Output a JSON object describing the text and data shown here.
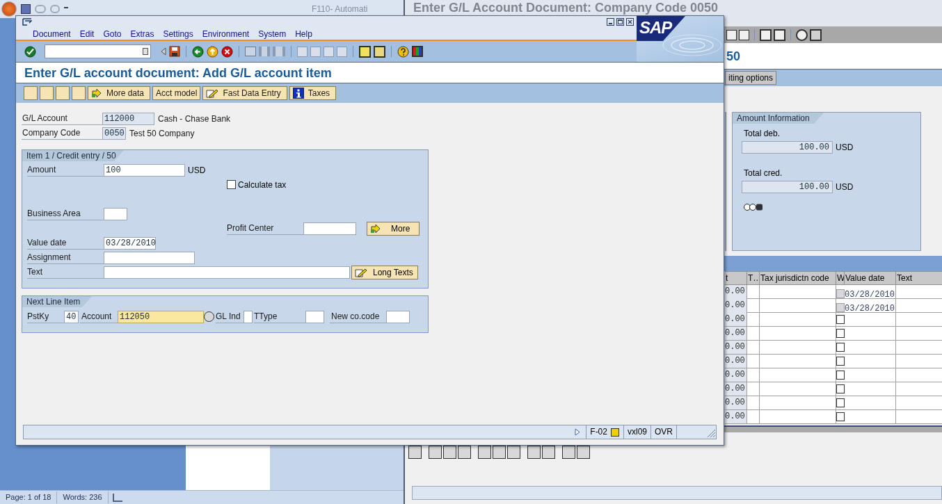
{
  "word": {
    "title": "F110- Automati",
    "status": [
      "Page: 1 of 18",
      "Words: 236"
    ]
  },
  "main_window": {
    "title": "Enter G/L Account Document: Company Code 0050",
    "heading": "50",
    "button": "iting options",
    "amount_panel": {
      "title": "Amount Information",
      "totals": [
        {
          "label": "Total deb.",
          "value": "100.00",
          "currency": "USD"
        },
        {
          "label": "Total cred.",
          "value": "100.00",
          "currency": "USD"
        }
      ]
    },
    "table": {
      "columns": [
        "t",
        "T…",
        "Tax jurisdictn code",
        "W",
        "Value date",
        "Text"
      ],
      "rows": [
        {
          "amount": "0.00",
          "value_date": "03/28/2010",
          "marked": true
        },
        {
          "amount": "0.00",
          "value_date": "03/28/2010",
          "marked": true
        },
        {
          "amount": "0.00",
          "marked": false
        },
        {
          "amount": "0.00",
          "marked": false
        },
        {
          "amount": "0.00",
          "marked": false
        },
        {
          "amount": "0.00",
          "marked": false
        },
        {
          "amount": "0.00",
          "marked": false
        },
        {
          "amount": "0.00",
          "marked": false
        },
        {
          "amount": "0.00",
          "marked": false
        },
        {
          "amount": "0.00",
          "marked": false
        }
      ]
    }
  },
  "dialog": {
    "logo_text": "SAP",
    "menu": [
      "Document",
      "Edit",
      "Goto",
      "Extras",
      "Settings",
      "Environment",
      "System",
      "Help"
    ],
    "title": "Enter G/L account document: Add G/L account item",
    "buttons": [
      {
        "label": "More data",
        "kind": "arrow"
      },
      {
        "label": "Acct model",
        "kind": "plain"
      },
      {
        "label": "Fast Data Entry",
        "kind": "pen"
      },
      {
        "label": "Taxes",
        "kind": "info"
      }
    ],
    "header": [
      {
        "label": "G/L Account",
        "value": "112000",
        "text": "Cash - Chase Bank"
      },
      {
        "label": "Company Code",
        "value": "0050",
        "text": "Test 50 Company"
      }
    ],
    "item": {
      "title": "Item 1 / Credit entry / 50",
      "amount": {
        "label": "Amount",
        "value": "100",
        "currency": "USD"
      },
      "calculate_tax": {
        "label": "Calculate tax",
        "checked": false
      },
      "business_area": {
        "label": "Business Area"
      },
      "profit_center": {
        "label": "Profit Center"
      },
      "more_button": "More",
      "value_date": {
        "label": "Value date",
        "value": "03/28/2010"
      },
      "assignment": {
        "label": "Assignment"
      },
      "text": {
        "label": "Text"
      },
      "long_texts_button": "Long Texts"
    },
    "next_line": {
      "title": "Next Line Item",
      "posting_key": {
        "label": "PstKy",
        "value": "40"
      },
      "account": {
        "label": "Account",
        "value": "112050"
      },
      "gl_ind": {
        "label": "GL Ind"
      },
      "ttype": {
        "label": "TType"
      },
      "new_co_code": {
        "label": "New co.code"
      }
    },
    "status": {
      "transaction": "F-02",
      "server": "vxl09",
      "mode": "OVR"
    }
  }
}
